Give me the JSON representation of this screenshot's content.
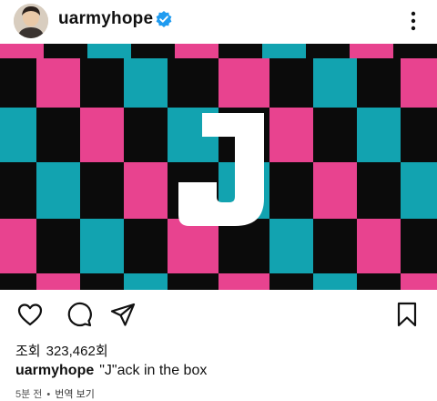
{
  "post": {
    "username": "uarmyhope",
    "verified": true,
    "views_label": "조회",
    "views_value": "323,462회",
    "caption_user": "uarmyhope",
    "caption_text": "\"J\"ack in the box",
    "time_ago": "5분 전",
    "separator": "•",
    "translate_label": "번역 보기"
  },
  "media": {
    "letter": "J",
    "colors": {
      "pink": "#e8438f",
      "teal": "#12a3b0",
      "black": "#0b0b0b",
      "letter": "#ffffff"
    }
  },
  "icons": {
    "more": "more-vertical-icon",
    "verified": "verified-badge-icon",
    "mute": "speaker-muted-icon",
    "like": "heart-icon",
    "comment": "comment-icon",
    "share": "send-icon",
    "save": "bookmark-icon"
  }
}
